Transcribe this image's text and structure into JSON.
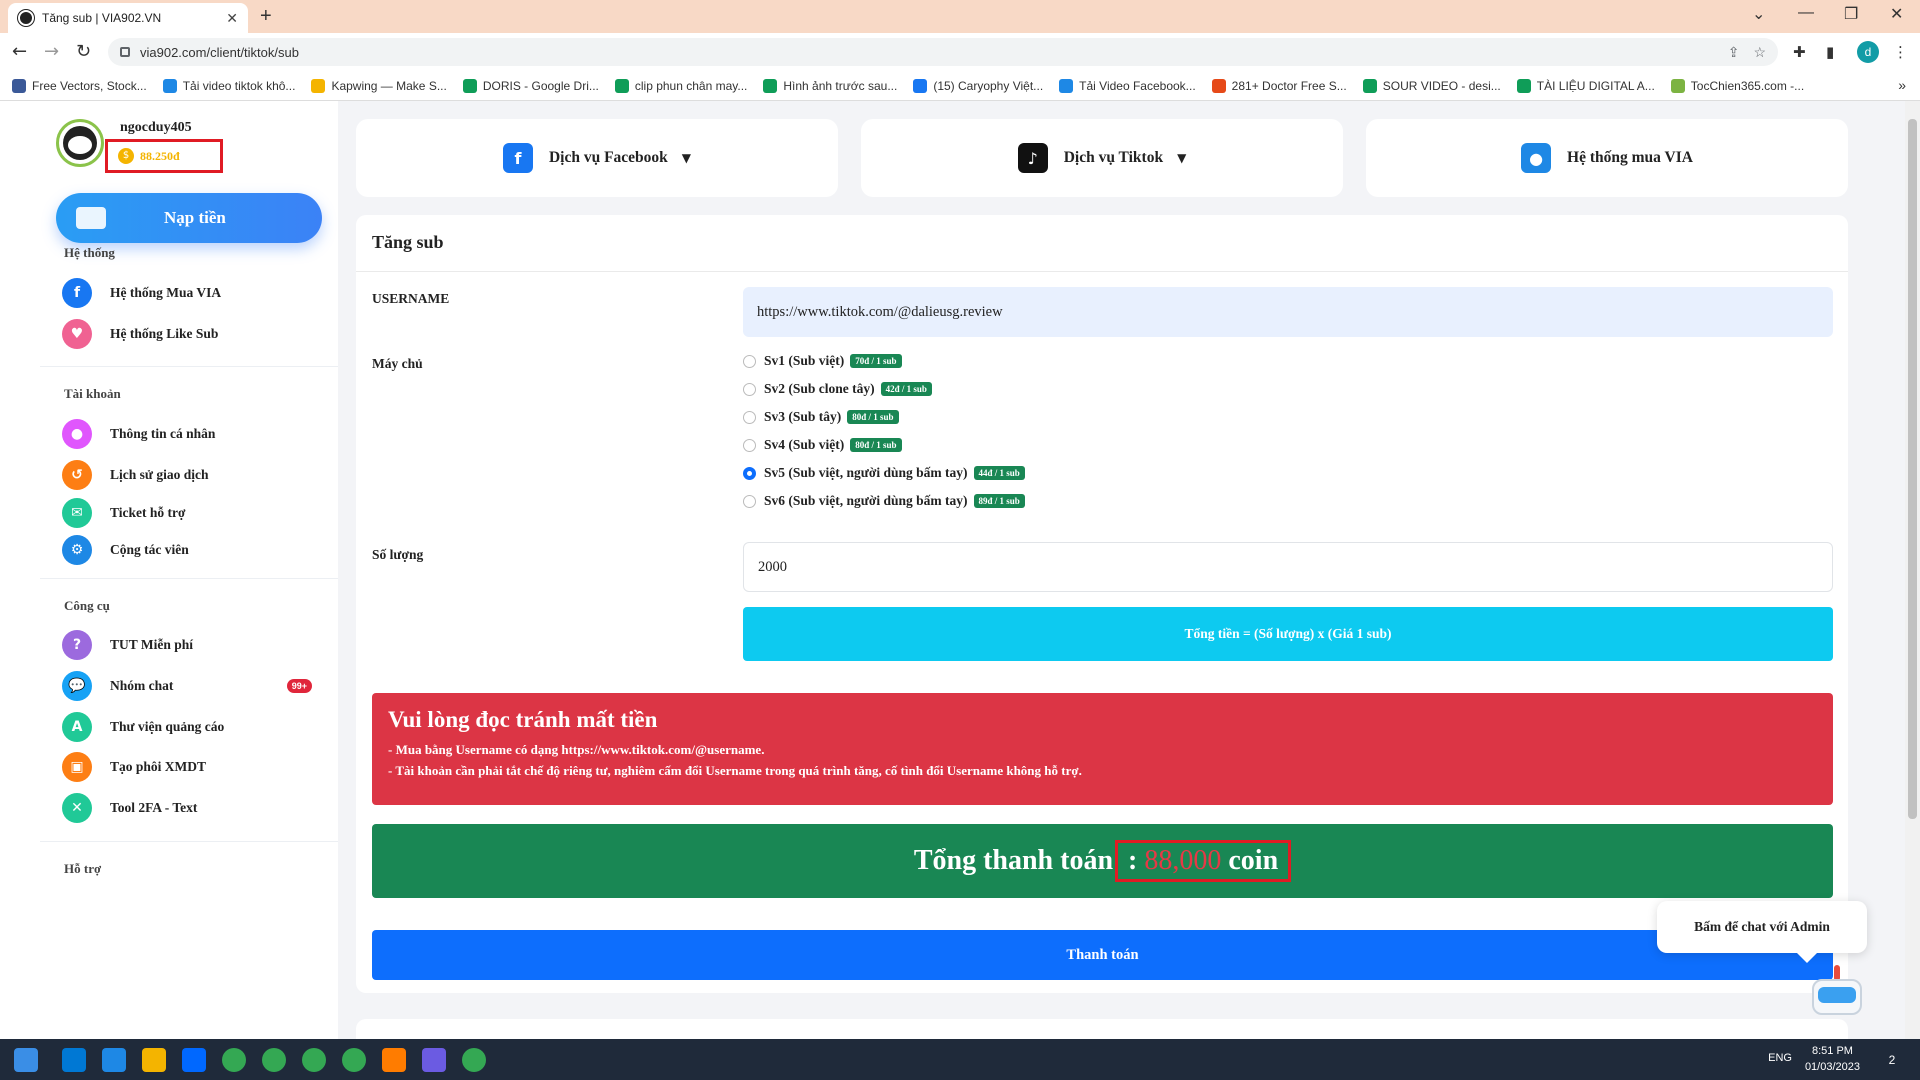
{
  "browser": {
    "tab_title": "Tăng sub | VIA902.VN",
    "tab_close": "✕",
    "new_tab": "+",
    "url": "via902.com/client/tiktok/sub",
    "window_controls": [
      "⌄",
      "—",
      "❐",
      "✕"
    ],
    "profile_initial": "d",
    "bookmarks": [
      {
        "label": "Free Vectors, Stock...",
        "color": "#3b5998"
      },
      {
        "label": "Tải video tiktok khô...",
        "color": "#1e88e5"
      },
      {
        "label": "Kapwing — Make S...",
        "color": "#f4b400"
      },
      {
        "label": "DORIS - Google Dri...",
        "color": "#0f9d58"
      },
      {
        "label": "clip phun chân may...",
        "color": "#0f9d58"
      },
      {
        "label": "Hình ảnh trước sau...",
        "color": "#0f9d58"
      },
      {
        "label": "(15) Caryophy Việt...",
        "color": "#1877f2"
      },
      {
        "label": "Tải Video Facebook...",
        "color": "#1e88e5"
      },
      {
        "label": "281+ Doctor Free S...",
        "color": "#e64a19"
      },
      {
        "label": "SOUR VIDEO - desi...",
        "color": "#0f9d58"
      },
      {
        "label": "TÀI LIỆU DIGITAL A...",
        "color": "#0f9d58"
      },
      {
        "label": "TocChien365.com -...",
        "color": "#7cb342"
      }
    ],
    "bookmarks_more": "»"
  },
  "sidebar": {
    "username": "ngocduy405",
    "balance": "88.250đ",
    "topup_label": "Nạp tiền",
    "sections": [
      {
        "title": "Hệ thống",
        "items": [
          {
            "label": "Hệ thống Mua VIA",
            "icon": "facebook-icon",
            "color": "#1877f2",
            "glyph": "f"
          },
          {
            "label": "Hệ thống Like Sub",
            "icon": "heart-icon",
            "color": "#f06292",
            "glyph": "♥"
          }
        ]
      },
      {
        "title": "Tài khoản",
        "items": [
          {
            "label": "Thông tin cá nhân",
            "icon": "user-icon",
            "color": "#e056fd",
            "glyph": "●"
          },
          {
            "label": "Lịch sử giao dịch",
            "icon": "history-icon",
            "color": "#fd7e14",
            "glyph": "↺"
          },
          {
            "label": "Ticket hỗ trợ",
            "icon": "ticket-icon",
            "color": "#20c997",
            "glyph": "✉"
          },
          {
            "label": "Cộng tác viên",
            "icon": "partner-icon",
            "color": "#1e88e5",
            "glyph": "⚙"
          }
        ]
      },
      {
        "title": "Công cụ",
        "items": [
          {
            "label": "TUT Miễn phí",
            "icon": "question-icon",
            "color": "#9c6ade",
            "glyph": "?"
          },
          {
            "label": "Nhóm chat",
            "icon": "chat-icon",
            "color": "#17a2f5",
            "glyph": "💬",
            "badge": "99+"
          },
          {
            "label": "Thư viện quảng cáo",
            "icon": "ads-icon",
            "color": "#20c997",
            "glyph": "A"
          },
          {
            "label": "Tạo phôi XMDT",
            "icon": "id-card-icon",
            "color": "#fd7e14",
            "glyph": "▣"
          },
          {
            "label": "Tool 2FA - Text",
            "icon": "tool-icon",
            "color": "#20c997",
            "glyph": "✕"
          }
        ]
      },
      {
        "title": "Hỗ trợ",
        "items": []
      }
    ]
  },
  "services": [
    {
      "label": "Dịch vụ Facebook",
      "icon": "facebook-icon",
      "color": "#1877f2",
      "glyph": "f",
      "dropdown": true
    },
    {
      "label": "Dịch vụ Tiktok",
      "icon": "tiktok-icon",
      "color": "#111",
      "glyph": "♪",
      "dropdown": true
    },
    {
      "label": "Hệ thống mua VIA",
      "icon": "user-icon",
      "color": "#1e88e5",
      "glyph": "●",
      "dropdown": false
    }
  ],
  "form": {
    "title": "Tăng sub",
    "username_label": "USERNAME",
    "username_value": "https://www.tiktok.com/@dalieusg.review",
    "server_label": "Máy chủ",
    "servers": [
      {
        "label": "Sv1 (Sub việt)",
        "price": "70đ / 1 sub",
        "selected": false
      },
      {
        "label": "Sv2 (Sub clone tây)",
        "price": "42đ / 1 sub",
        "selected": false
      },
      {
        "label": "Sv3 (Sub tây)",
        "price": "80đ / 1 sub",
        "selected": false
      },
      {
        "label": "Sv4 (Sub việt)",
        "price": "80đ / 1 sub",
        "selected": false
      },
      {
        "label": "Sv5 (Sub việt, người dùng bấm tay)",
        "price": "44đ / 1 sub",
        "selected": true
      },
      {
        "label": "Sv6 (Sub việt, người dùng bấm tay)",
        "price": "89đ / 1 sub",
        "selected": false
      }
    ],
    "quantity_label": "Số lượng",
    "quantity_value": "2000",
    "formula": "Tổng tiền = (Số lượng) x (Giá 1 sub)",
    "warning_title": "Vui lòng đọc tránh mất tiền",
    "warning_lines": [
      "- Mua bằng Username có dạng https://www.tiktok.com/@username.",
      "- Tài khoản cần phải tắt chế độ riêng tư, nghiêm cấm đổi Username trong quá trình tăng, cố tình đổi Username không hỗ trợ."
    ],
    "total_prefix": "Tổng thanh toán",
    "total_colon": ":",
    "total_amount": "88,000",
    "total_unit": "coin",
    "pay_label": "Thanh toán"
  },
  "chat": {
    "label": "Bấm để chat với Admin"
  },
  "taskbar": {
    "lang": "ENG",
    "time": "8:51 PM",
    "date": "01/03/2023",
    "notifications": "2",
    "apps": [
      "#0078d4",
      "#1e88e5",
      "#f4b400",
      "#0068ff",
      "#34a853",
      "#34a853",
      "#34a853",
      "#34a853",
      "#ff7c00",
      "#6b5be2",
      "#34a853"
    ]
  }
}
